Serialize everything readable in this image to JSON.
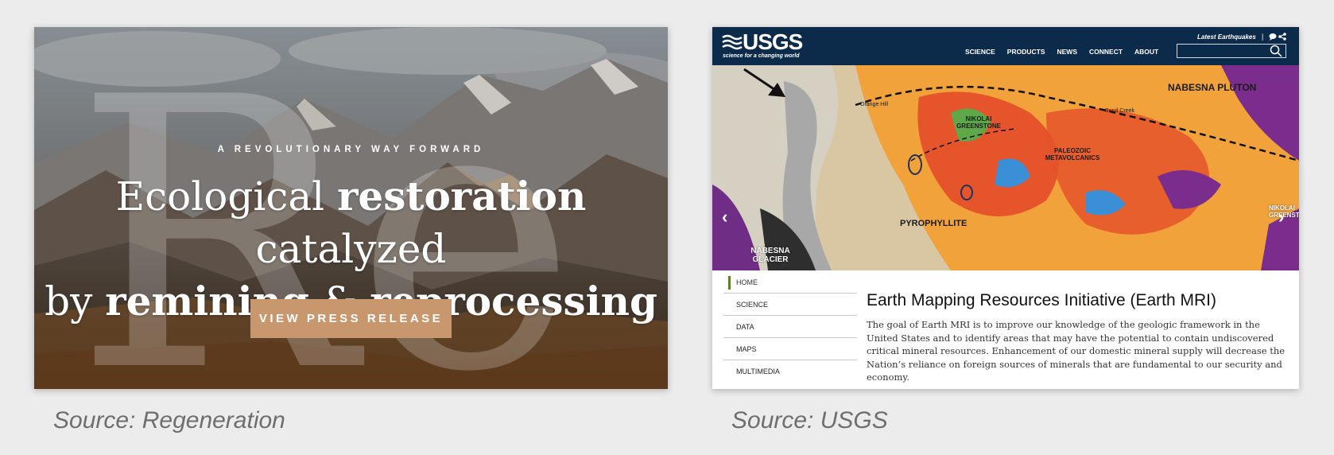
{
  "regeneration": {
    "eyebrow": "A REVOLUTIONARY WAY FORWARD",
    "headline_parts": [
      "Ecological ",
      "restoration",
      " catalyzed",
      "by ",
      "remining",
      " & ",
      "reprocessing"
    ],
    "watermark": "Re",
    "button_label": "VIEW PRESS RELEASE",
    "button_color": "#c9976d"
  },
  "usgs": {
    "logo_text": "USGS",
    "tagline": "science for a changing world",
    "nav": [
      "SCIENCE",
      "PRODUCTS",
      "NEWS",
      "CONNECT",
      "ABOUT"
    ],
    "latest_link": "Latest Earthquakes",
    "separator": "|",
    "header_color": "#0c2a4a",
    "map_labels": {
      "nabesna_pluton": "NABESNA PLUTON",
      "orange_hill": "Orange Hill",
      "nikolai_greenstone": "NIKOLAI GREENSTONE",
      "bond_creek": "Bond Creek",
      "paleozoic": "PALEOZOIC METAVOLCANICS",
      "pyrophyllite": "PYROPHYLLITE",
      "nabesna_glacier": "NABESNA GLACIER",
      "nikolai_edge": "NIKOLAI GREENSTO"
    },
    "carousel_dots": 5,
    "carousel_active": 1,
    "side_nav": [
      "HOME",
      "SCIENCE",
      "DATA",
      "MAPS",
      "MULTIMEDIA"
    ],
    "title": "Earth Mapping Resources Initiative (Earth MRI)",
    "body": "The goal of Earth MRI is to improve our knowledge of the geologic framework in the United States and to identify areas that may have the potential to contain undiscovered critical mineral resources. Enhancement of our domestic mineral supply will decrease the Nation’s reliance on foreign sources of minerals that are fundamental to our security and economy."
  },
  "captions": {
    "left": "Source: Regeneration",
    "right": "Source: USGS"
  }
}
